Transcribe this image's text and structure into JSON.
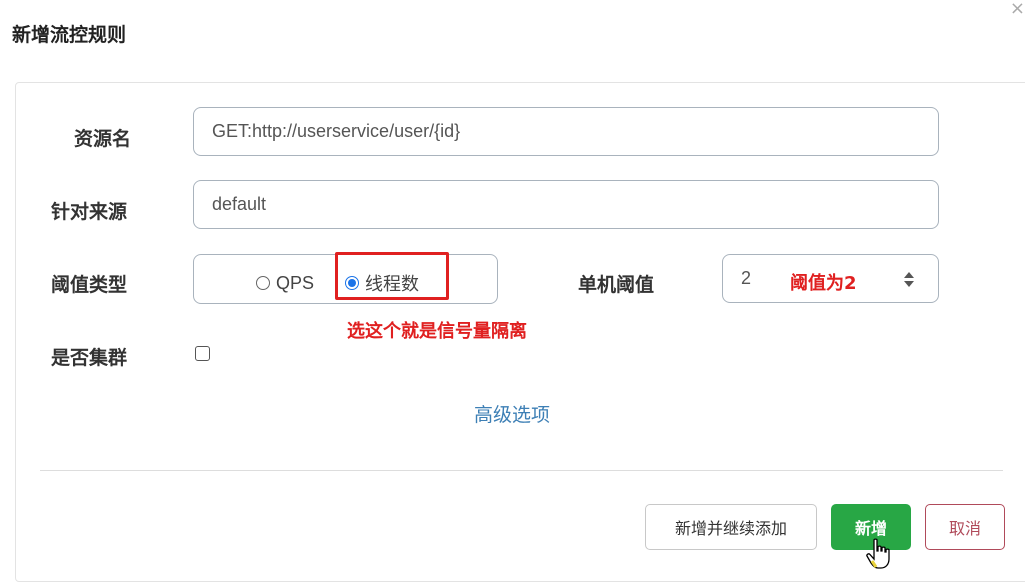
{
  "dialog": {
    "title": "新增流控规则",
    "close_icon": "×"
  },
  "form": {
    "resource": {
      "label": "资源名",
      "value": "GET:http://userservice/user/{id}"
    },
    "source": {
      "label": "针对来源",
      "value": "default"
    },
    "threshold_type": {
      "label": "阈值类型",
      "options": [
        {
          "label": "QPS",
          "checked": false
        },
        {
          "label": "线程数",
          "checked": true
        }
      ]
    },
    "single_threshold": {
      "label": "单机阈值",
      "value": "2"
    },
    "cluster": {
      "label": "是否集群",
      "checked": false
    },
    "advanced_link": "高级选项"
  },
  "annotations": {
    "threshold_note": "阈值为2",
    "semaphore_note": "选这个就是信号量隔离",
    "highlight_color": "#e02020"
  },
  "buttons": {
    "add_continue": "新增并继续添加",
    "add": "新增",
    "cancel": "取消"
  },
  "colors": {
    "primary_green": "#28a745",
    "cancel_red": "#b04a5a",
    "link_blue": "#3d7fb5",
    "radio_blue": "#1a73e8"
  }
}
